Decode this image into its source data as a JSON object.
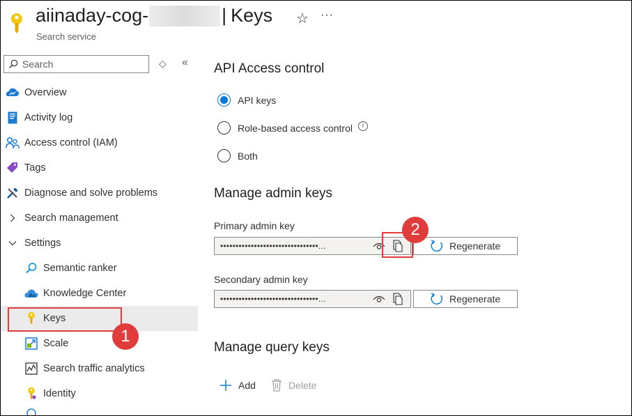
{
  "header": {
    "resource_name": "aiinaday-cog-",
    "page_name": "Keys",
    "separator": "|",
    "subtitle": "Search service",
    "favorite_icon": "star-icon",
    "more_icon": "ellipsis-icon",
    "more_label": "···"
  },
  "sidebar": {
    "search_placeholder": "Search",
    "items": [
      {
        "label": "Overview",
        "icon": "overview-icon"
      },
      {
        "label": "Activity log",
        "icon": "activity-log-icon"
      },
      {
        "label": "Access control (IAM)",
        "icon": "people-icon"
      },
      {
        "label": "Tags",
        "icon": "tag-icon"
      },
      {
        "label": "Diagnose and solve problems",
        "icon": "wrench-icon"
      },
      {
        "label": "Search management",
        "icon": "chevron-right-icon"
      },
      {
        "label": "Settings",
        "icon": "chevron-down-icon"
      },
      {
        "label": "Semantic ranker",
        "icon": "search-icon"
      },
      {
        "label": "Knowledge Center",
        "icon": "cloud-icon"
      },
      {
        "label": "Keys",
        "icon": "key-icon",
        "selected": true
      },
      {
        "label": "Scale",
        "icon": "scale-icon"
      },
      {
        "label": "Search traffic analytics",
        "icon": "chart-icon"
      },
      {
        "label": "Identity",
        "icon": "identity-icon"
      }
    ]
  },
  "annotations": {
    "badge_1": "1",
    "badge_2": "2",
    "color": "#e03c3c"
  },
  "main": {
    "api_access": {
      "title": "API Access control",
      "options": [
        "API keys",
        "Role-based access control",
        "Both"
      ],
      "selected": "API keys",
      "info_glyph": "i"
    },
    "admin_keys": {
      "title": "Manage admin keys",
      "primary_label": "Primary admin key",
      "primary_value": "••••••••••••••••••••••••••••••••...",
      "secondary_label": "Secondary admin key",
      "secondary_value": "••••••••••••••••••••••••••••••••...",
      "regenerate_label": "Regenerate"
    },
    "query_keys": {
      "title": "Manage query keys",
      "add_label": "Add",
      "delete_label": "Delete"
    }
  },
  "colors": {
    "accent": "#0078d4",
    "annotation": "#e03c3c",
    "selected_bg": "#ebebeb"
  }
}
